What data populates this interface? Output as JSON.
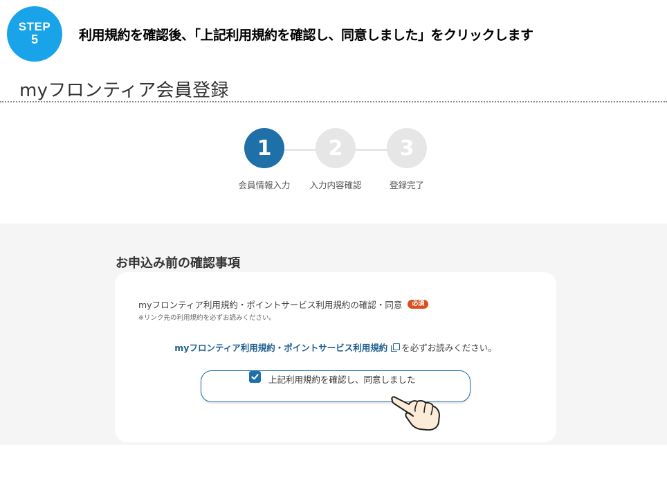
{
  "step_badge": {
    "word": "STEP",
    "number": "5"
  },
  "instruction": "利用規約を確認後、「上記利用規約を確認し、同意しました」をクリックします",
  "page_title": "myフロンティア会員登録",
  "stepper": [
    {
      "num": "1",
      "label": "会員情報入力",
      "active": true
    },
    {
      "num": "2",
      "label": "入力内容確認",
      "active": false
    },
    {
      "num": "3",
      "label": "登録完了",
      "active": false
    }
  ],
  "section_heading": "お申込み前の確認事項",
  "card": {
    "question_label": "myフロンティア利用規約・ポイントサービス利用規約の確認・同意",
    "required_badge": "必須",
    "note": "※リンク先の利用規約を必ずお読みください。",
    "link_text": "myフロンティア利用規約・ポイントサービス利用規約",
    "link_suffix": "を必ずお読みください。",
    "checkbox_label": "上記利用規約を確認し、同意しました",
    "checkbox_checked": true
  },
  "colors": {
    "accent": "#1f6fa8",
    "badge": "#19a3e8",
    "required": "#d8501e"
  }
}
